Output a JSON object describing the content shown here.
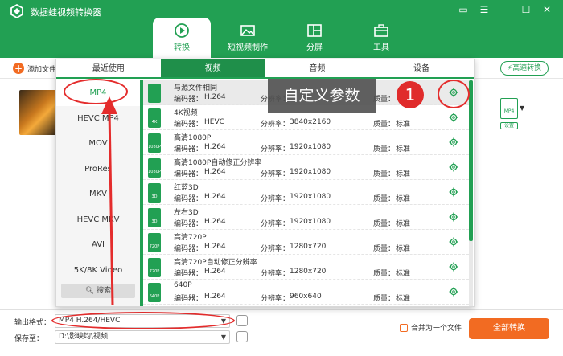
{
  "app": {
    "title": "数据蛙视频转换器",
    "window_controls": [
      "▭",
      "☰",
      "—",
      "☐",
      "✕"
    ]
  },
  "nav_tabs": [
    {
      "label": "转换",
      "icon": "convert-icon",
      "active": true
    },
    {
      "label": "短视频制作",
      "icon": "image-icon",
      "active": false
    },
    {
      "label": "分屏",
      "icon": "split-screen-icon",
      "active": false
    },
    {
      "label": "工具",
      "icon": "toolbox-icon",
      "active": false
    }
  ],
  "toolbar": {
    "add_file": "添加文件",
    "fast_convert": "高速转换"
  },
  "format_preview": {
    "file_label": "MP4",
    "settings_label": "设置"
  },
  "panel": {
    "category_tabs": [
      "最近使用",
      "视频",
      "音频",
      "设备"
    ],
    "active_category": 1,
    "formats": [
      "MP4",
      "HEVC MP4",
      "MOV",
      "ProRes",
      "MKV",
      "HEVC MKV",
      "AVI",
      "5K/8K Video"
    ],
    "active_format": 0,
    "search_label": "搜索",
    "presets": [
      {
        "name": "与源文件相同",
        "encoder_label": "编码器：",
        "encoder": "H.264",
        "res_label": "分辨率：",
        "resolution": "",
        "quality_label": "质量：",
        "quality": "",
        "badge": "",
        "selected": true
      },
      {
        "name": "4K视频",
        "encoder_label": "编码器：",
        "encoder": "HEVC",
        "res_label": "分辨率：",
        "resolution": "3840x2160",
        "quality_label": "质量：",
        "quality": "标准",
        "badge": "4K",
        "selected": false
      },
      {
        "name": "高清1080P",
        "encoder_label": "编码器：",
        "encoder": "H.264",
        "res_label": "分辨率：",
        "resolution": "1920x1080",
        "quality_label": "质量：",
        "quality": "标准",
        "badge": "1080P",
        "selected": false
      },
      {
        "name": "高清1080P自动修正分辨率",
        "encoder_label": "编码器：",
        "encoder": "H.264",
        "res_label": "分辨率：",
        "resolution": "1920x1080",
        "quality_label": "质量：",
        "quality": "标准",
        "badge": "1080P",
        "selected": false
      },
      {
        "name": "红蓝3D",
        "encoder_label": "编码器：",
        "encoder": "H.264",
        "res_label": "分辨率：",
        "resolution": "1920x1080",
        "quality_label": "质量：",
        "quality": "标准",
        "badge": "3D",
        "selected": false
      },
      {
        "name": "左右3D",
        "encoder_label": "编码器：",
        "encoder": "H.264",
        "res_label": "分辨率：",
        "resolution": "1920x1080",
        "quality_label": "质量：",
        "quality": "标准",
        "badge": "3D",
        "selected": false
      },
      {
        "name": "高清720P",
        "encoder_label": "编码器：",
        "encoder": "H.264",
        "res_label": "分辨率：",
        "resolution": "1280x720",
        "quality_label": "质量：",
        "quality": "标准",
        "badge": "720P",
        "selected": false
      },
      {
        "name": "高清720P自动修正分辨率",
        "encoder_label": "编码器：",
        "encoder": "H.264",
        "res_label": "分辨率：",
        "resolution": "1280x720",
        "quality_label": "质量：",
        "quality": "标准",
        "badge": "720P",
        "selected": false
      },
      {
        "name": "640P",
        "encoder_label": "编码器：",
        "encoder": "H.264",
        "res_label": "分辨率：",
        "resolution": "960x640",
        "quality_label": "质量：",
        "quality": "标准",
        "badge": "640P",
        "selected": false
      }
    ]
  },
  "bottom": {
    "output_format_label": "输出格式：",
    "output_format_value": "MP4 H.264/HEVC",
    "save_to_label": "保存至：",
    "save_to_value": "D:\\影映均\\视频",
    "merge_label": "合并为一个文件",
    "convert_all": "全部转换"
  },
  "annotations": {
    "tooltip": "自定义参数",
    "badge": "1"
  },
  "colors": {
    "brand_green": "#22a053",
    "accent_orange": "#f26b22",
    "annotation_red": "#e42c2c"
  }
}
